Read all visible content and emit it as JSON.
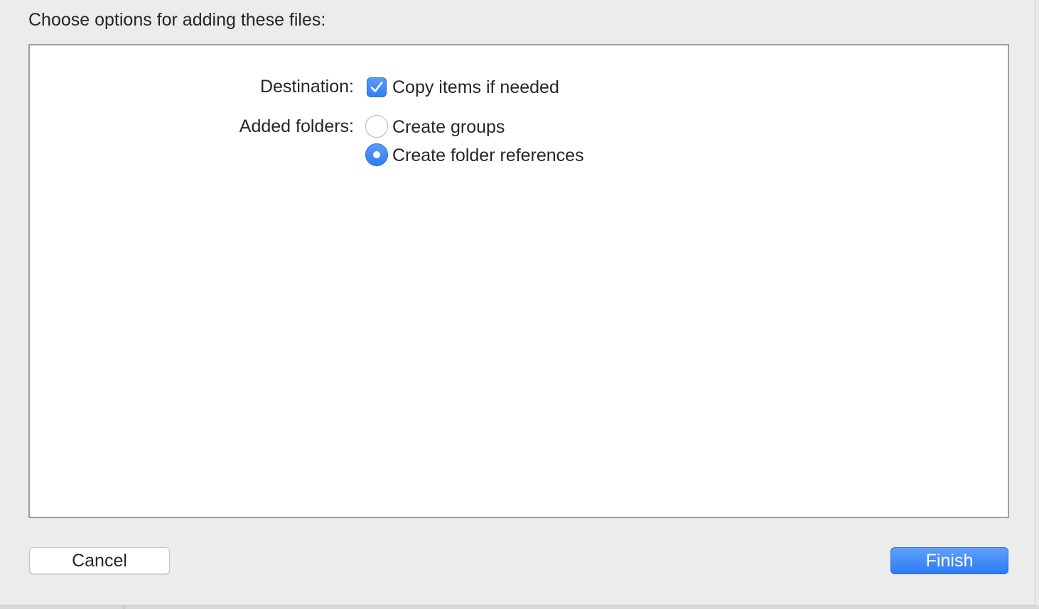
{
  "header": {
    "title": "Choose options for adding these files:"
  },
  "options": {
    "destination": {
      "label": "Destination:",
      "checkbox_label": "Copy items if needed",
      "checked": true
    },
    "added_folders": {
      "label": "Added folders:",
      "choices": [
        {
          "label": "Create groups",
          "selected": false
        },
        {
          "label": "Create folder references",
          "selected": true
        }
      ]
    }
  },
  "buttons": {
    "cancel_label": "Cancel",
    "finish_label": "Finish"
  },
  "colors": {
    "accent": "#3b86f5",
    "sheet_background": "#ececec",
    "panel_background": "#ffffff"
  },
  "icons": {
    "checkbox": "checkmark-icon"
  }
}
